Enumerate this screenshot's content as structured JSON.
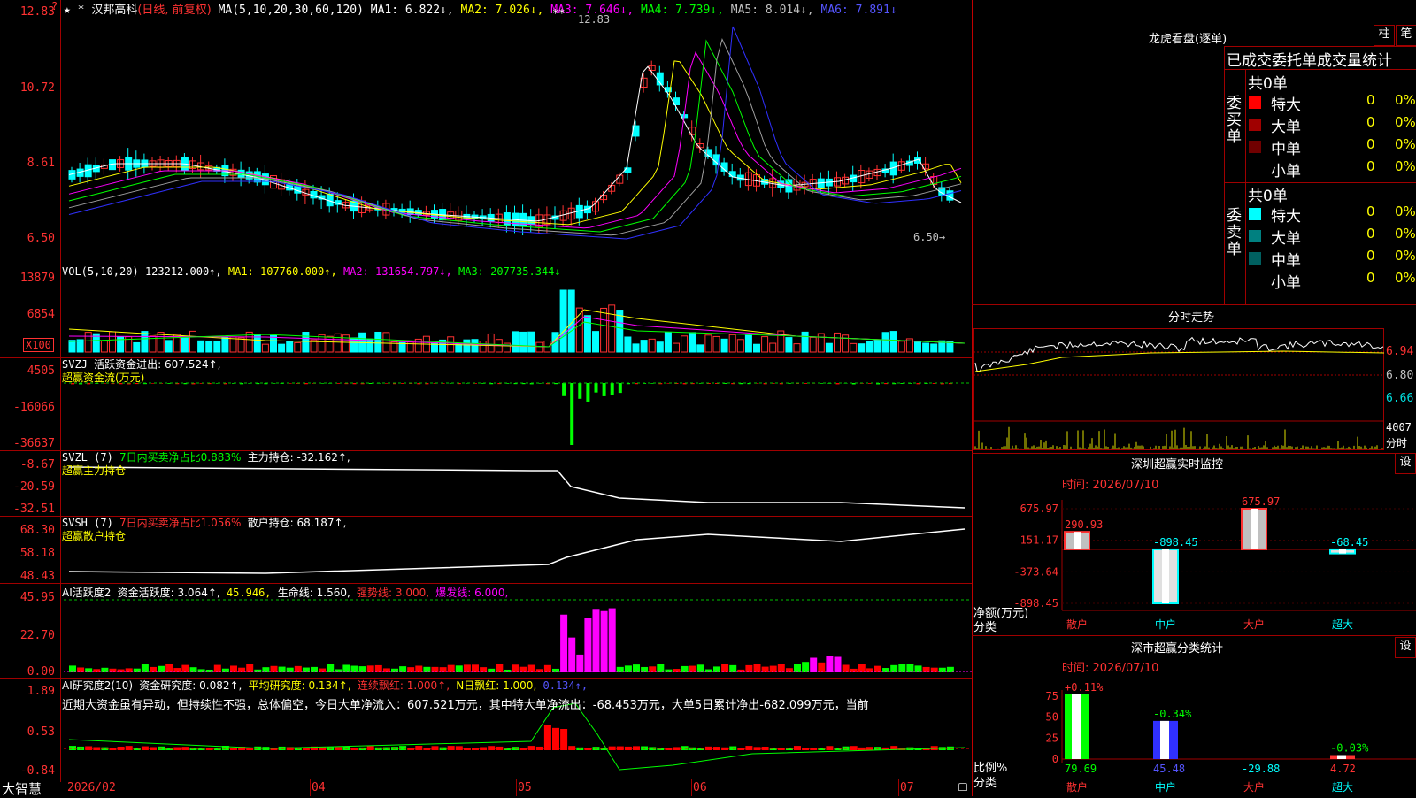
{
  "app": {
    "logo": "大智慧"
  },
  "colors": {
    "up": "#ff3232",
    "down": "#00ffff",
    "bg": "#000000",
    "grid": "#a00000",
    "ma1": "#ffffff",
    "ma2": "#ffff00",
    "ma3": "#ff00ff",
    "ma4": "#00ff00",
    "ma5": "#a0a0a0",
    "ma6": "#3030ff"
  },
  "kline": {
    "icons": "★ *",
    "stock_name": "汉邦高科",
    "period": "(日线, 前复权)",
    "ma_params": "MA(5,10,20,30,60,120)",
    "ma1": "MA1: 6.822↓,",
    "ma2": "MA2: 7.026↓,",
    "ma3": "MA3: 7.646↓,",
    "ma4": "MA4: 7.739↓,",
    "ma5": "MA5: 8.014↓,",
    "ma6": "MA6: 7.891↓",
    "y_labels": [
      "12.83",
      "10.72",
      "8.61",
      "6.50"
    ],
    "high_label": "12.83",
    "high_marker": "**",
    "low_label": "6.50→",
    "corner_mark": "?"
  },
  "vol": {
    "title": "VOL(5,10,20)",
    "value": "123212.000↑,",
    "ma1": "MA1: 107760.000↑,",
    "ma2": "MA2: 131654.797↓,",
    "ma3": "MA3: 207735.344↓",
    "y_labels": [
      "13879",
      "6854"
    ],
    "unit": "X100"
  },
  "svzj": {
    "title": "SVZJ",
    "line1": "活跃资金进出: 607.524↑,",
    "line2": "超赢资金流(万元)",
    "y_labels": [
      "4505",
      "-16066",
      "-36637"
    ]
  },
  "svzl": {
    "title": "SVZL (7)",
    "ratio": "7日内买卖净占比0.883%",
    "hold": "主力持仓: -32.162↑,",
    "line2": "超赢主力持仓",
    "y_labels": [
      "-8.67",
      "-20.59",
      "-32.51"
    ]
  },
  "svsh": {
    "title": "SVSH (7)",
    "ratio": "7日内买卖净占比1.056%",
    "hold": "散户持仓: 68.187↑,",
    "line2": "超赢散户持仓",
    "y_labels": [
      "68.30",
      "58.18",
      "48.43"
    ]
  },
  "ai_active": {
    "title": "AI活跃度2",
    "v1": "资金活跃度: 3.064↑,",
    "v2": "45.946,",
    "v3": "生命线: 1.560,",
    "v4": "强势线: 3.000,",
    "v5": "爆发线: 6.000,",
    "y_labels": [
      "45.95",
      "22.70",
      "0.00"
    ]
  },
  "ai_research": {
    "title": "AI研究度2(10)",
    "v1": "资金研究度: 0.082↑,",
    "v2": "平均研究度: 0.134↑,",
    "v3": "连续飘红: 1.000↑,",
    "v4": "N日飘红: 1.000,",
    "v5": "0.134↑,",
    "comment": "近期大资金虽有异动，但持续性不强，总体偏空，今日大单净流入：607.521万元，其中特大单净流出：-68.453万元，大单5日累计净出-682.099万元，当前",
    "y_labels": [
      "1.89",
      "0.53",
      "-0.84"
    ]
  },
  "x_axis": [
    "2026/02",
    "04",
    "05",
    "06",
    "07"
  ],
  "dragon": {
    "title": "龙虎看盘(逐单)",
    "btn_bar": "柱",
    "btn_pen": "笔",
    "subtitle": "已成交委托单成交量统计",
    "buy_label": "委买单",
    "sell_label": "委卖单",
    "buy_total": "共0单",
    "sell_total": "共0单",
    "buy_rows": [
      {
        "name": "特大",
        "count": "0",
        "pct": "0%",
        "color": "#ff0000"
      },
      {
        "name": "大单",
        "count": "0",
        "pct": "0%",
        "color": "#a00000"
      },
      {
        "name": "中单",
        "count": "0",
        "pct": "0%",
        "color": "#700000"
      },
      {
        "name": "小单",
        "count": "0",
        "pct": "0%",
        "color": "#000000"
      }
    ],
    "sell_rows": [
      {
        "name": "特大",
        "count": "0",
        "pct": "0%",
        "color": "#00ffff"
      },
      {
        "name": "大单",
        "count": "0",
        "pct": "0%",
        "color": "#008080"
      },
      {
        "name": "中单",
        "count": "0",
        "pct": "0%",
        "color": "#006060"
      },
      {
        "name": "小单",
        "count": "0",
        "pct": "0%",
        "color": "#000000"
      }
    ]
  },
  "intraday": {
    "title": "分时走势",
    "y_labels": [
      "6.94",
      "6.80",
      "6.66"
    ],
    "vol_label": "4007",
    "vol_unit": "分时"
  },
  "monitor": {
    "title": "深圳超赢实时监控",
    "btn": "设",
    "time": "时间: 2026/07/10",
    "y_labels": [
      "675.97",
      "151.17",
      "-373.64",
      "-898.45"
    ],
    "y_title": "净额(万元)",
    "x_title": "分类",
    "bars": [
      {
        "name": "散户",
        "value": 290.93,
        "label": "290.93"
      },
      {
        "name": "中户",
        "value": -898.45,
        "label": "-898.45"
      },
      {
        "name": "大户",
        "value": 675.97,
        "label": "675.97"
      },
      {
        "name": "超大",
        "value": -68.45,
        "label": "-68.45"
      }
    ]
  },
  "classify": {
    "title": "深市超赢分类统计",
    "btn": "设",
    "time": "时间: 2026/07/10",
    "y_labels": [
      "75",
      "50",
      "25",
      "0"
    ],
    "y_title": "比例%",
    "x_title": "分类",
    "bars": [
      {
        "name": "散户",
        "value": 79.69,
        "label": "79.69",
        "top": "+0.11%"
      },
      {
        "name": "中户",
        "value": 45.48,
        "label": "45.48",
        "top": "-0.34%"
      },
      {
        "name": "大户",
        "value": -29.88,
        "label": "-29.88",
        "top": ""
      },
      {
        "name": "超大",
        "value": 4.72,
        "label": "4.72",
        "top": "-0.03%"
      }
    ]
  }
}
